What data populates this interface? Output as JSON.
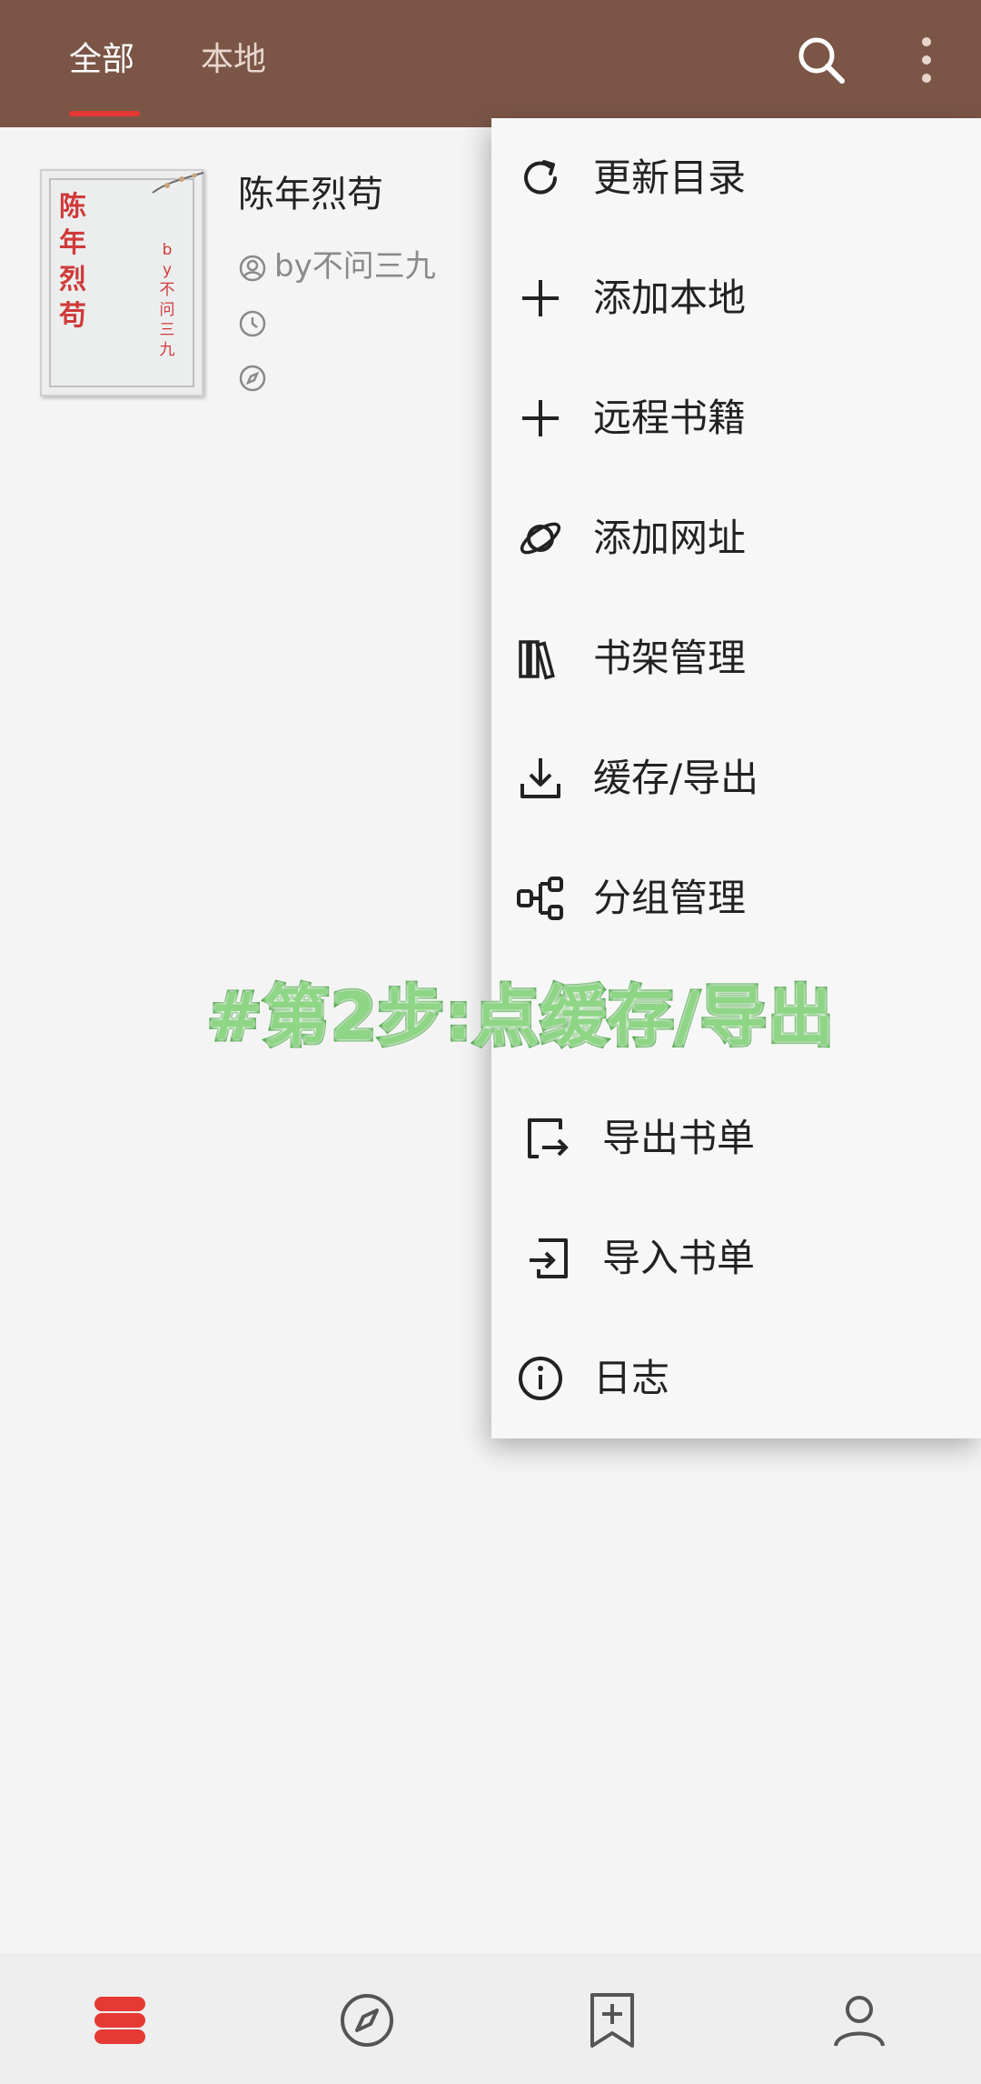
{
  "topbar": {
    "tabs": [
      {
        "label": "全部",
        "active": true
      },
      {
        "label": "本地",
        "active": false
      }
    ],
    "background": "#7b5647",
    "indicator_color": "#e53935",
    "icons": [
      "search-icon",
      "more-vert-icon"
    ]
  },
  "book": {
    "title": "陈年烈苟",
    "author": "by不问三九",
    "cover_title": "陈年烈苟",
    "cover_author": "by不问三九"
  },
  "menu": {
    "items": [
      {
        "label": "更新目录",
        "icon": "refresh-icon"
      },
      {
        "label": "添加本地",
        "icon": "plus-icon"
      },
      {
        "label": "远程书籍",
        "icon": "plus-icon"
      },
      {
        "label": "添加网址",
        "icon": "planet-icon"
      },
      {
        "label": "书架管理",
        "icon": "books-icon"
      },
      {
        "label": "缓存/导出",
        "icon": "download-icon"
      },
      {
        "label": "分组管理",
        "icon": "group-icon"
      },
      {
        "label": "导出书单",
        "icon": "export-icon"
      },
      {
        "label": "导入书单",
        "icon": "import-icon"
      },
      {
        "label": "日志",
        "icon": "info-icon"
      }
    ]
  },
  "annotation": {
    "text": "#第2步:点缓存/导出",
    "color": "#8fd586"
  },
  "bottomnav": {
    "items": [
      {
        "icon": "bookshelf-icon",
        "active": true,
        "color": "#e53935"
      },
      {
        "icon": "compass-icon",
        "active": false
      },
      {
        "icon": "bookmark-add-icon",
        "active": false
      },
      {
        "icon": "person-icon",
        "active": false
      }
    ]
  }
}
